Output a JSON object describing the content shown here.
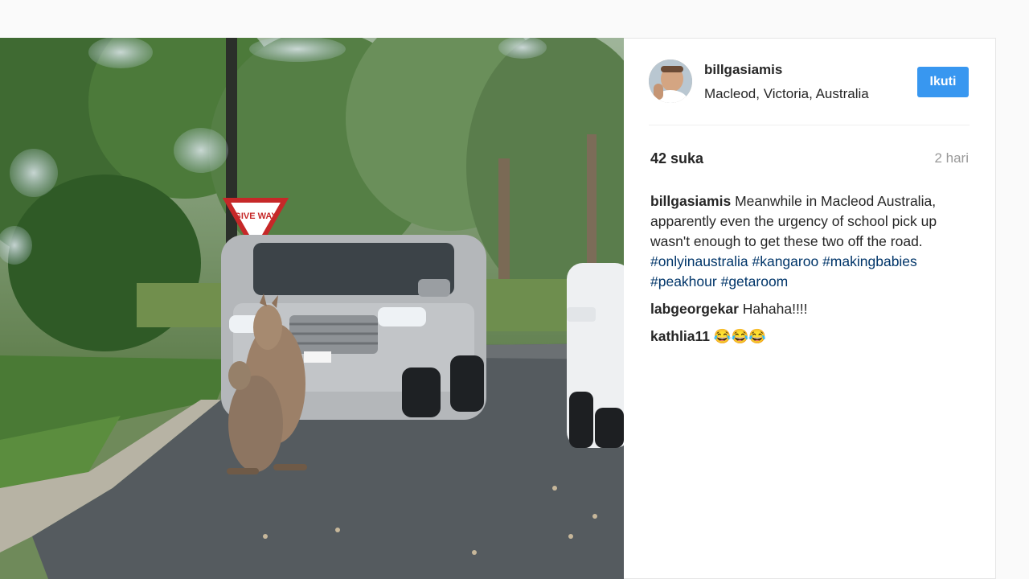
{
  "post": {
    "image_alt": "Two kangaroos on a suburban road in front of a silver SUV",
    "sign_text": "GIVE WAY",
    "username": "billgasiamis",
    "location": "Macleod, Victoria, Australia",
    "follow_label": "Ikuti",
    "likes": "42 suka",
    "time": "2 hari",
    "caption_user": "billgasiamis",
    "caption_text": "Meanwhile in Macleod Australia, apparently even the urgency of school pick up wasn't enough to get these two off the road.",
    "hashtags": [
      "#onlyinaustralia",
      "#kangaroo",
      "#makingbabies",
      "#peakhour",
      "#getaroom"
    ],
    "comments": [
      {
        "user": "labgeorgekar",
        "text": "Hahaha!!!!"
      },
      {
        "user": "kathlia11",
        "text": "😂😂😂"
      }
    ]
  }
}
